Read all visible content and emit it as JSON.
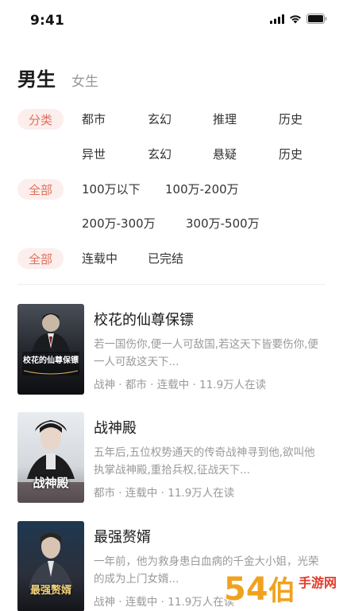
{
  "status_bar": {
    "time": "9:41"
  },
  "gender_tabs": {
    "male": "男生",
    "female": "女生"
  },
  "filters": {
    "category": {
      "chip": "分类",
      "row1": [
        "都市",
        "玄幻",
        "推理",
        "历史"
      ],
      "row2": [
        "异世",
        "玄幻",
        "悬疑",
        "历史"
      ]
    },
    "word_count": {
      "chip": "全部",
      "row1": [
        "100万以下",
        "100万-200万"
      ],
      "row2": [
        "200万-300万",
        "300万-500万"
      ]
    },
    "status": {
      "chip": "全部",
      "options": [
        "连载中",
        "已完结"
      ]
    }
  },
  "books": [
    {
      "title": "校花的仙尊保镖",
      "desc": "若一国伤你,便一人可敌国,若这天下皆要伤你,便一人可敌这天下...",
      "meta": "战神 · 都市 · 连载中 · 11.9万人在读",
      "cover_text": "校花的仙尊保镖"
    },
    {
      "title": "战神殿",
      "desc": "五年后,五位权势通天的传奇战神寻到他,欲叫他执掌战神殿,重拾兵权,征战天下...",
      "meta": "都市 · 连载中 · 11.9万人在读",
      "cover_text": "战神殿"
    },
    {
      "title": "最强赘婿",
      "desc": "一年前，他为救身患白血病的千金大小姐，光荣的成为上门女婿...",
      "meta": "战神 · 连载中 · 11.9万人在读",
      "cover_text": "最强赘婿"
    }
  ],
  "watermark": {
    "text": "54伯手游网"
  },
  "colors": {
    "accent": "#e0705c",
    "chip_bg": "#fbeeec",
    "muted": "#999999"
  }
}
